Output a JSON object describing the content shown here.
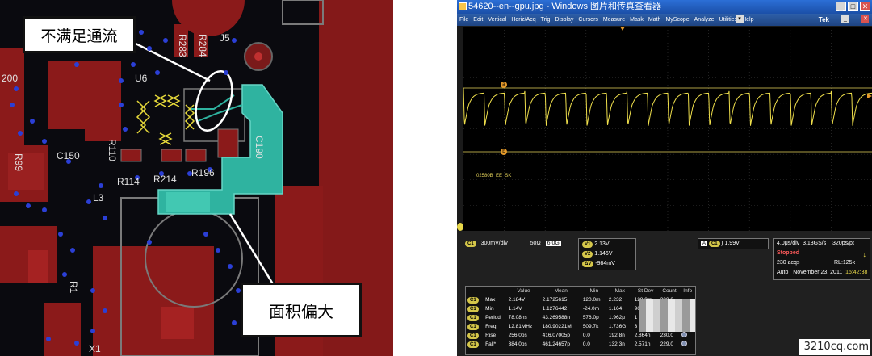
{
  "pcb": {
    "callout_top": "不满足通流",
    "callout_bottom": "面积偏大",
    "labels": {
      "j5": "J5",
      "u6": "U6",
      "r283": "R283",
      "r284": "R284",
      "c150": "C150",
      "r110": "R110",
      "r114": "R114",
      "r214": "R214",
      "r196": "R196",
      "c190": "C190",
      "r99": "R99",
      "l3": "L3",
      "x1": "X1",
      "r200": "200",
      "r1": "R1"
    }
  },
  "scope": {
    "window_title": "54620--en--gpu.jpg - Windows 图片和传真查看器",
    "menu": [
      "File",
      "Edit",
      "Vertical",
      "Horiz/Acq",
      "Trig",
      "Display",
      "Cursors",
      "Measure",
      "Mask",
      "Math",
      "MyScope",
      "Analyze",
      "Utilities",
      "Help"
    ],
    "brand": "Tek",
    "waveform_label": "02580B_EE_SK",
    "cursor_a": "a",
    "cursor_b": "b",
    "channel": {
      "name": "C1",
      "scale": "300mV/div",
      "impedance": "50Ω",
      "bandwidth": "6.0G"
    },
    "cursors": {
      "v1_label": "V1",
      "v1": "2.13V",
      "v2_label": "V2",
      "v2": "1.146V",
      "dv_label": "ΔV",
      "dv": "-984mV"
    },
    "trigger": {
      "mode": "A",
      "source": "C1",
      "level": "1.99V"
    },
    "acquisition": {
      "timebase": "4.0μs/div",
      "sample_rate": "3.13GS/s",
      "resolution": "320ps/pt",
      "state": "Stopped",
      "acqs": "230 acqs",
      "record": "RL:125k",
      "auto": "Auto",
      "date": "November 23, 2011",
      "time": "15:42:38"
    },
    "measurements": {
      "headers": [
        "",
        "",
        "Value",
        "Mean",
        "Min",
        "Max",
        "St Dev",
        "Count",
        "Info"
      ],
      "rows": [
        {
          "ch": "C1",
          "name": "Max",
          "value": "2.184V",
          "mean": "2.1725615",
          "min": "120.0m",
          "max": "2.232",
          "stdev": "128.9m",
          "count": "230.0",
          "info": ""
        },
        {
          "ch": "C1",
          "name": "Min",
          "value": "1.14V",
          "mean": "1.1276442",
          "min": "-24.0m",
          "max": "1.164",
          "stdev": "96",
          "count": "",
          "info": ""
        },
        {
          "ch": "C1",
          "name": "Period",
          "value": "78.08ns",
          "mean": "43.269588n",
          "min": "576.0p",
          "max": "1.962μ",
          "stdev": "1",
          "count": "",
          "info": ""
        },
        {
          "ch": "C1",
          "name": "Freq",
          "value": "12.81MHz",
          "mean": "180.90221M",
          "min": "509.7k",
          "max": "1.736G",
          "stdev": "3",
          "count": "",
          "info": ""
        },
        {
          "ch": "C1",
          "name": "Rise",
          "value": "256.0ps",
          "mean": "416.07005p",
          "min": "0.0",
          "max": "192.8n",
          "stdev": "2.864n",
          "count": "230.0",
          "info": "i"
        },
        {
          "ch": "C1",
          "name": "Fall*",
          "value": "384.0ps",
          "mean": "461.24657p",
          "min": "0.0",
          "max": "132.3n",
          "stdev": "2.571n",
          "count": "229.0",
          "info": "i"
        }
      ]
    }
  },
  "watermark": "3210cq.com",
  "colors": {
    "pcb_bg": "#0a0a0f",
    "copper_red": "#8b1a1a",
    "pour_teal": "#2fb3a0",
    "via_blue": "#2b3fd6",
    "trace_yellow": "#e6d93a",
    "scope_bg": "#000000"
  }
}
